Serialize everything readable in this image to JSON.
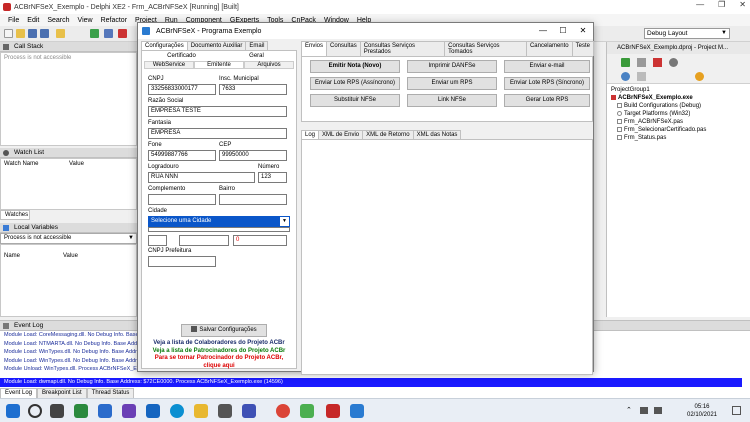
{
  "ide": {
    "title": "ACBrNFSeX_Exemplo - Delphi XE2 - Frm_ACBrNFSeX [Running] [Built]",
    "menu": [
      "File",
      "Edit",
      "Search",
      "View",
      "Refactor",
      "Project",
      "Run",
      "Component",
      "GExperts",
      "Tools",
      "CnPack",
      "Window",
      "Help"
    ],
    "layout_select": "Debug Layout"
  },
  "call_stack": {
    "title": "Call Stack",
    "message": "Process is not accessible"
  },
  "watch_list": {
    "title": "Watch List",
    "col_name": "Watch Name",
    "col_value": "Value",
    "tab": "Watches"
  },
  "local_vars": {
    "title": "Local Variables",
    "process": "Process is not accessible",
    "col_name": "Name",
    "col_value": "Value"
  },
  "event_log": {
    "title": "Event Log",
    "lines": [
      "Module Load: CoreMessaging.dll. No Debug Info. Base A",
      "Module Load: NTMARTA.dll. No Debug Info. Base Addres",
      "Module Load: WinTypes.dll. No Debug Info. Base Addre",
      "Module Load: WinTypes.dll. No Debug Info. Base Addre",
      "Module Unload: WinTypes.dll. Process ACBrNFSeX_Exe"
    ],
    "highlight": "Module Load: dwmapi.dll. No Debug Info. Base Address: $72CE0000. Process ACBrNFSeX_Exemplo.exe (14596)",
    "tabs": [
      "Event Log",
      "Breakpoint List",
      "Thread Status"
    ]
  },
  "project_mgr": {
    "header": "ACBrNFSeX_Exemplo.dproj - Project M...",
    "group": "ProjectGroup1",
    "items": [
      "ACBrNFSeX_Exemplo.exe",
      "Build Configurations (Debug)",
      "Target Platforms (Win32)",
      "Frm_ACBrNFSeX.pas",
      "Frm_SelecionarCertificado.pas",
      "Frm_Status.pas"
    ]
  },
  "dialog": {
    "title": "ACBrNFSeX - Programa Exemplo",
    "left_tabs": [
      "Configurações",
      "Documento Auxiliar",
      "Email"
    ],
    "sub_tabs_row1": [
      "Certificado",
      "Geral"
    ],
    "sub_tabs_row2": [
      "WebService",
      "Emitente",
      "Arquivos"
    ],
    "fields": {
      "cnpj_lbl": "CNPJ",
      "cnpj": "33256833000177",
      "im_lbl": "Insc. Municipal",
      "im": "7633",
      "razao_lbl": "Razão Social",
      "razao": "EMPRESA TESTE",
      "fantasia_lbl": "Fantasia",
      "fantasia": "EMPRESA",
      "fone_lbl": "Fone",
      "fone": "54999887766",
      "cep_lbl": "CEP",
      "cep": "99950000",
      "logr_lbl": "Logradouro",
      "logr": "RUA NNN",
      "num_lbl": "Número",
      "num": "123",
      "compl_lbl": "Complemento",
      "compl": "",
      "bairro_lbl": "Bairro",
      "bairro": "",
      "cidade_lbl": "Cidade",
      "cidade": "Selecione uma Cidade",
      "zero": "0",
      "cnpj_pref_lbl": "CNPJ Prefeitura",
      "cnpj_pref": ""
    },
    "save_btn": "Salvar Configurações",
    "links": [
      "Veja a lista de Colaboradores do Projeto ACBr",
      "Veja a lista de Patrocinadores do Projeto ACBr",
      "Para se tornar Patrocinador do Projeto ACBr,",
      "clique aqui"
    ],
    "right_tabs": [
      "Envios",
      "Consultas",
      "Consultas Serviços Prestados",
      "Consultas Serviços Tomados",
      "Cancelamento",
      "Teste"
    ],
    "buttons": [
      [
        "Emitir Nota (Novo)",
        "Imprimir DANFSe",
        "Enviar e-mail"
      ],
      [
        "Enviar Lote RPS (Assíncrono)",
        "Enviar um RPS",
        "Enviar Lote RPS (Síncrono)"
      ],
      [
        "Substituir NFSe",
        "Link NFSe",
        "Gerar Lote RPS"
      ]
    ],
    "log_tabs": [
      "Log",
      "XML de Envio",
      "XML de Retorno",
      "XML das Notas"
    ]
  },
  "clock": {
    "time": "05:16",
    "date": "02/10/2021"
  }
}
